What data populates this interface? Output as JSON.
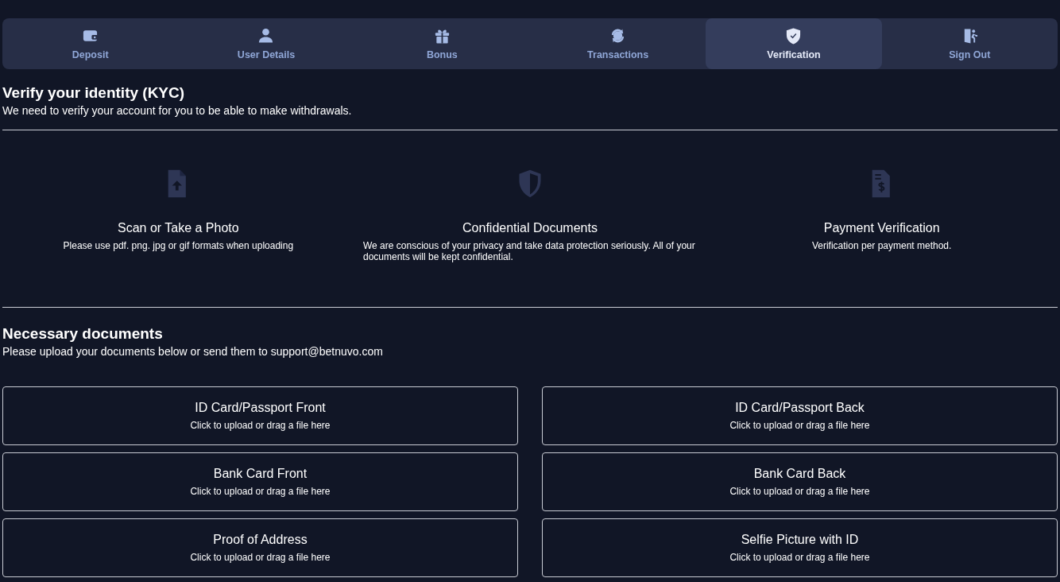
{
  "tabs": [
    {
      "label": "Deposit",
      "selected": false
    },
    {
      "label": "User Details",
      "selected": false
    },
    {
      "label": "Bonus",
      "selected": false
    },
    {
      "label": "Transactions",
      "selected": false
    },
    {
      "label": "Verification",
      "selected": true
    },
    {
      "label": "Sign Out",
      "selected": false
    }
  ],
  "intro": {
    "title": "Verify your identity (KYC)",
    "text": "We need to verify your account for you to be able to make withdrawals."
  },
  "features": [
    {
      "title": "Scan or Take a Photo",
      "text": "Please use pdf. png. jpg or gif formats when uploading"
    },
    {
      "title": "Confidential Documents",
      "text": "We are conscious of your privacy and take data protection seriously. All of your documents will be kept confidential."
    },
    {
      "title": "Payment Verification",
      "text": "Verification per payment method."
    }
  ],
  "documents": {
    "title": "Necessary documents",
    "text": "Please upload your documents below or send them to support@betnuvo.com",
    "uploads": [
      {
        "title": "ID Card/Passport Front",
        "hint": "Click to upload or drag a file here"
      },
      {
        "title": "ID Card/Passport Back",
        "hint": "Click to upload or drag a file here"
      },
      {
        "title": "Bank Card Front",
        "hint": "Click to upload or drag a file here"
      },
      {
        "title": "Bank Card Back",
        "hint": "Click to upload or drag a file here"
      },
      {
        "title": "Proof of Address",
        "hint": "Click to upload or drag a file here"
      },
      {
        "title": "Selfie Picture with ID",
        "hint": "Click to upload or drag a file here"
      }
    ]
  }
}
